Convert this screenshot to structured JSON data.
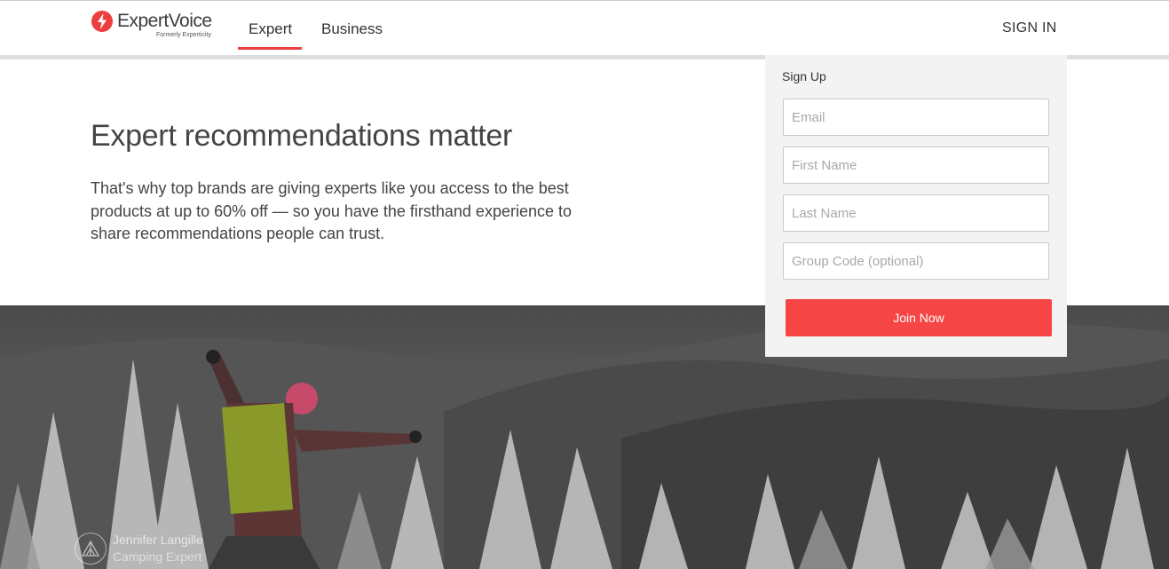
{
  "header": {
    "logo_text": "ExpertVoice",
    "logo_subtext": "Formerly Experticity",
    "tabs": [
      {
        "label": "Expert",
        "active": true
      },
      {
        "label": "Business",
        "active": false
      }
    ],
    "signin_label": "SIGN IN"
  },
  "hero": {
    "title": "Expert recommendations matter",
    "body": "That's why top brands are giving experts like you access to the best products at up to 60% off — so you have the firsthand experience to share recommendations people can trust."
  },
  "signup": {
    "title": "Sign Up",
    "fields": [
      {
        "name": "email",
        "placeholder": "Email",
        "value": ""
      },
      {
        "name": "first-name",
        "placeholder": "First Name",
        "value": ""
      },
      {
        "name": "last-name",
        "placeholder": "Last Name",
        "value": ""
      },
      {
        "name": "group-code",
        "placeholder": "Group Code (optional)",
        "value": ""
      }
    ],
    "button_label": "Join Now"
  },
  "photo_credit": {
    "name": "Jennifer Langille",
    "role": "Camping Expert",
    "icon": "tent-icon"
  },
  "colors": {
    "accent": "#ee3f3f",
    "button": "#f64545",
    "panel": "#f3f3f3"
  }
}
